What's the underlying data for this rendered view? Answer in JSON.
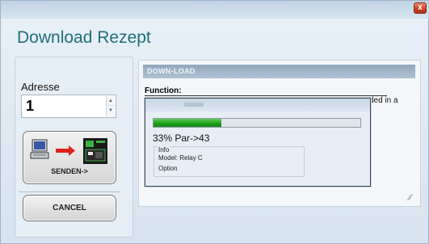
{
  "window": {
    "title": "Download Rezept",
    "close_glyph": "x"
  },
  "address": {
    "label": "Adresse",
    "value": "1"
  },
  "buttons": {
    "send_label": "SENDEN->",
    "cancel_label": "CANCEL"
  },
  "panel": {
    "header": "DOWN-LOAD",
    "function_label": "Function:",
    "function_text_visible": "ded in a"
  },
  "progress": {
    "fraction": 0.33,
    "text": "33% Par->43",
    "info_label": "Info",
    "model_text": "Model: Relay C",
    "option_label": "Option"
  },
  "colors": {
    "title": "#1e6f7c",
    "progress_fill": "#1fa21a",
    "close_button": "#c64126",
    "send_arrow": "#e0201a"
  },
  "icons": {
    "close": "close-icon",
    "computer": "computer-icon",
    "arrow": "arrow-right-icon",
    "device": "device-icon",
    "resize": "resize-grip-icon",
    "spin_up": "chevron-up-icon",
    "spin_down": "chevron-down-icon"
  }
}
